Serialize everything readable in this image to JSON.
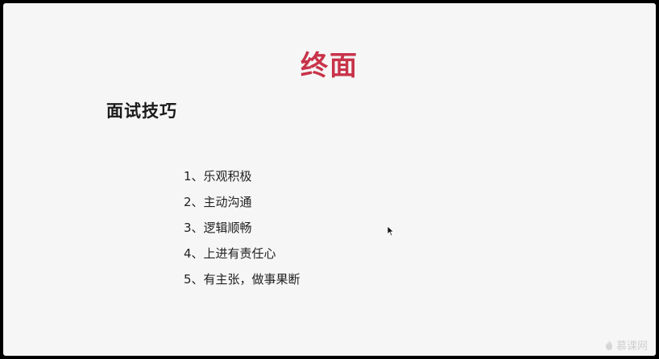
{
  "slide": {
    "title": "终面",
    "subtitle": "面试技巧",
    "tips": [
      "1、乐观积极",
      "2、主动沟通",
      "3、逻辑顺畅",
      "4、上进有责任心",
      "5、有主张，做事果断"
    ]
  },
  "watermark": {
    "text": "慕课网"
  },
  "colors": {
    "title": "#c8334a",
    "background": "#f6f6f6",
    "frame": "#000000"
  },
  "icons": {
    "cursor": "mouse-pointer-icon",
    "watermark": "flame-logo-icon"
  }
}
